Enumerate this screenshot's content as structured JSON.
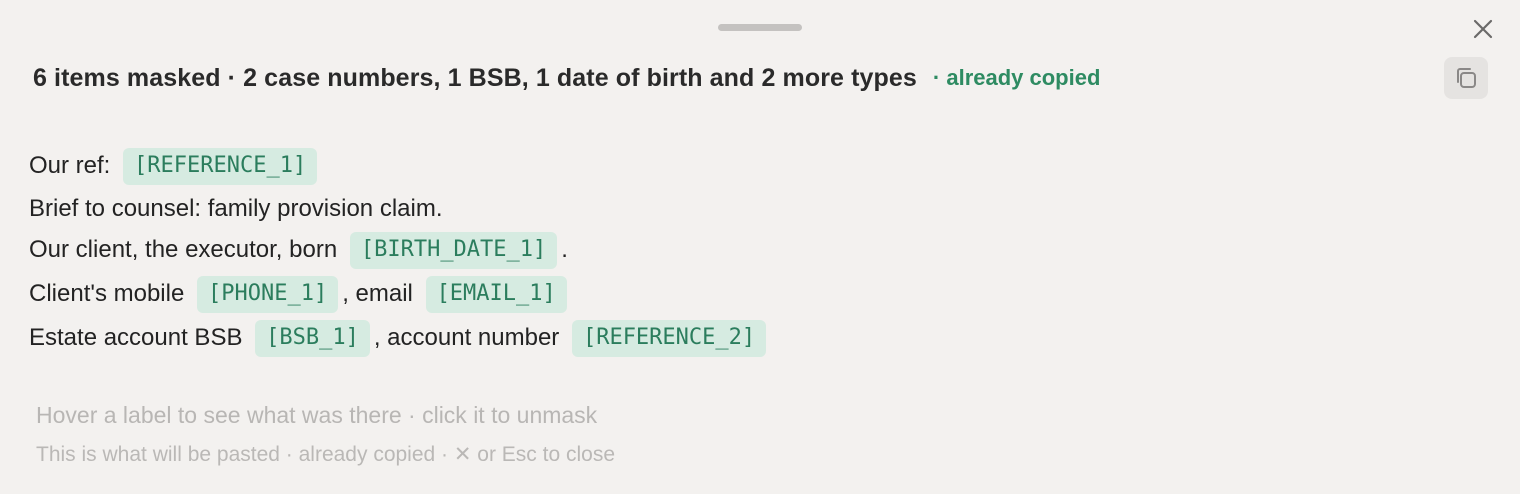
{
  "header": {
    "summary": "6 items masked · 2 case numbers, 1 BSB, 1 date of birth and 2 more types",
    "copied_status": "· already copied"
  },
  "icons": {
    "close": "close-icon",
    "copy": "copy-icon"
  },
  "colors": {
    "accent": "#2e8b62",
    "tag_background": "#d6ebe1",
    "tag_text": "#2b7d5d",
    "panel_background": "#f3f1ef"
  },
  "content": {
    "line1": {
      "text": "Our ref: ",
      "tag1": "[REFERENCE_1]"
    },
    "line2": {
      "text": "Brief to counsel: family provision claim."
    },
    "line3": {
      "text": "Our client, the executor, born ",
      "tag1": "[BIRTH_DATE_1]",
      "after": "."
    },
    "line4": {
      "text": "Client's mobile ",
      "tag1": "[PHONE_1]",
      "middle": ", email ",
      "tag2": "[EMAIL_1]"
    },
    "line5": {
      "text": "Estate account BSB ",
      "tag1": "[BSB_1]",
      "middle": ", account number ",
      "tag2": "[REFERENCE_2]"
    }
  },
  "footer": {
    "hint": "Hover a label to see what was there · click it to unmask",
    "note": "This is what will be pasted · already copied · ✕ or Esc to close"
  }
}
